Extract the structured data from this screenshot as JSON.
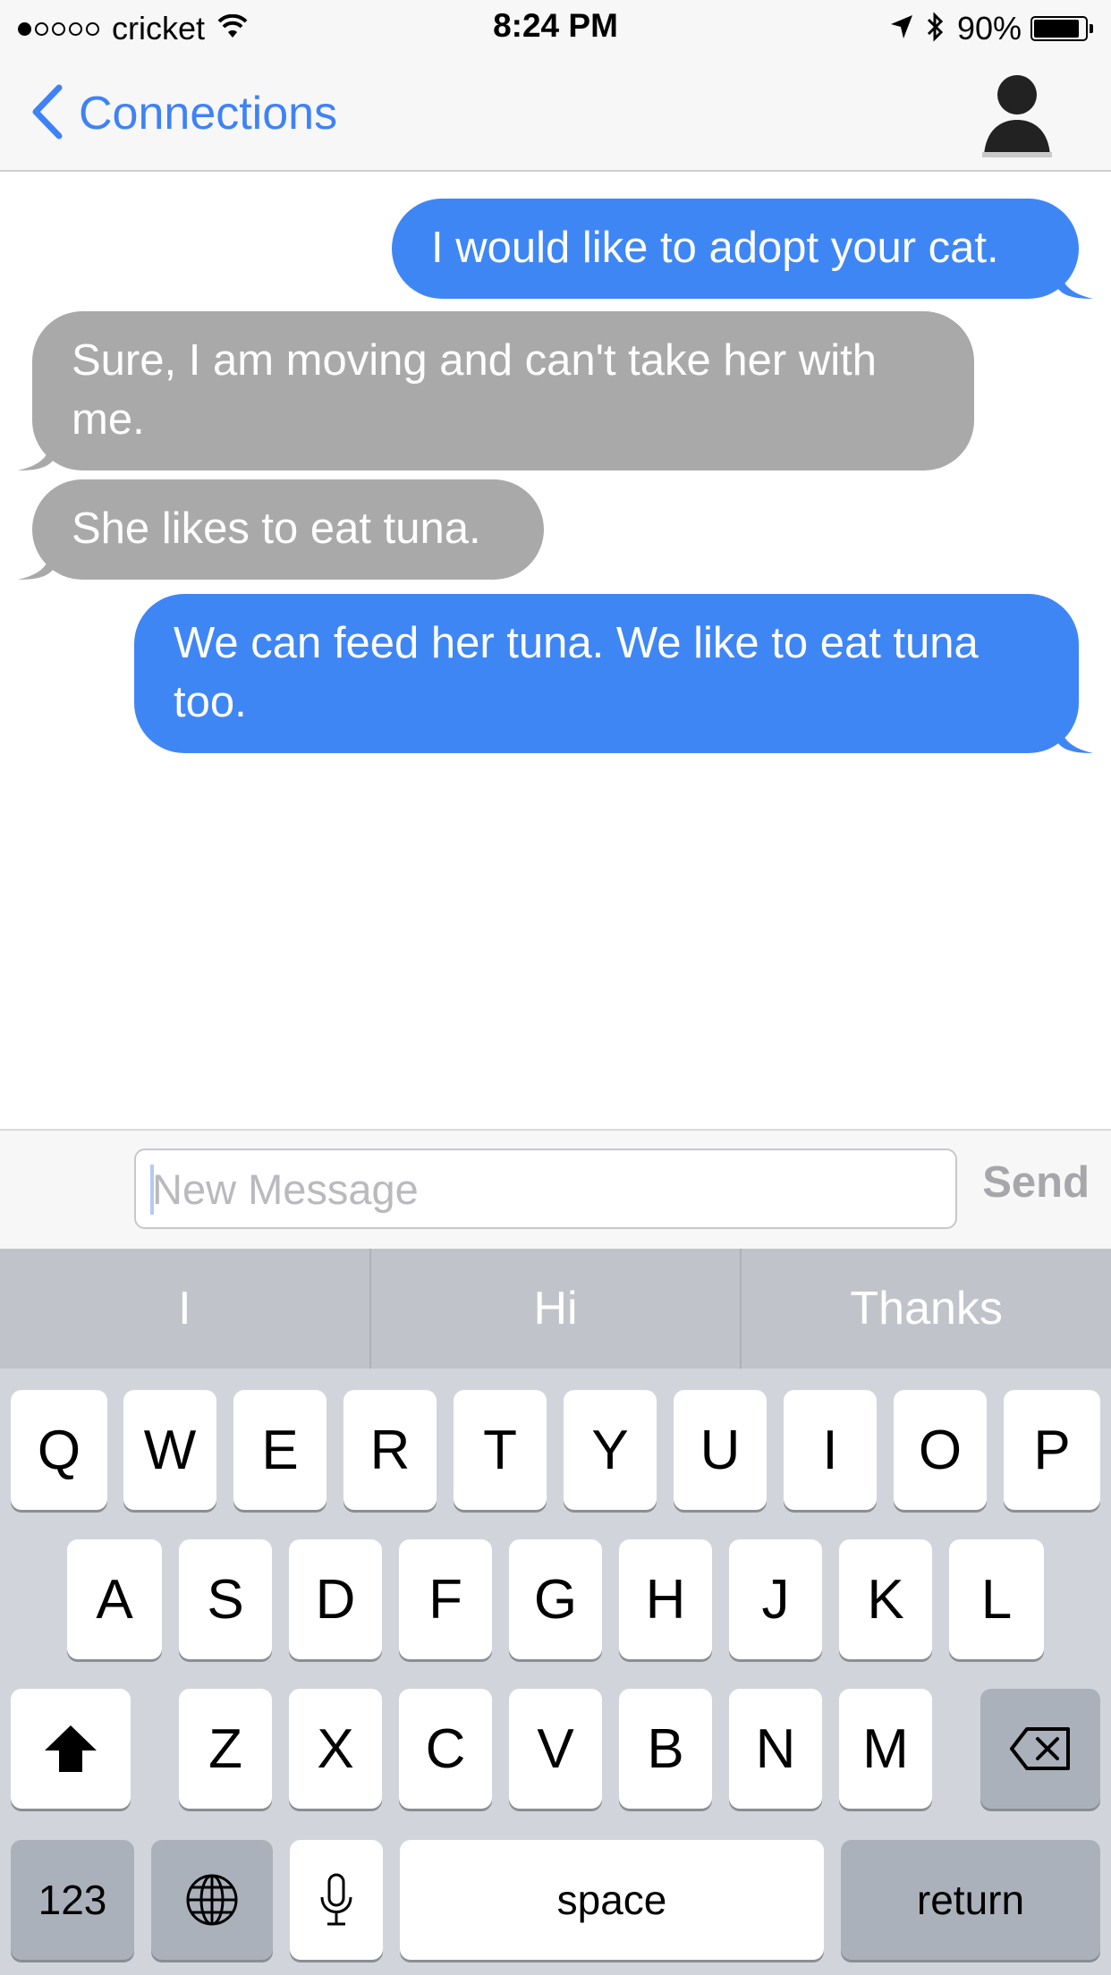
{
  "status_bar": {
    "carrier": "cricket",
    "time": "8:24 PM",
    "battery": "90%",
    "battery_level": 0.9,
    "signal_bars_filled": 1,
    "icons": [
      "signal-dots-icon",
      "wifi-icon",
      "location-arrow-icon",
      "bluetooth-icon",
      "battery-icon"
    ]
  },
  "nav": {
    "back_label": "Connections",
    "back_icon": "chevron-left-icon",
    "profile_icon": "person-silhouette-icon"
  },
  "messages": [
    {
      "direction": "outgoing",
      "text": "I would like to adopt your cat."
    },
    {
      "direction": "incoming",
      "text": "Sure, I am moving and can't take her with me."
    },
    {
      "direction": "incoming",
      "text": "She likes to eat tuna."
    },
    {
      "direction": "outgoing",
      "text": "We can feed her tuna.  We like to eat tuna too."
    }
  ],
  "input": {
    "placeholder": "New Message",
    "value": "",
    "send_label": "Send"
  },
  "predictive": [
    "I",
    "Hi",
    "Thanks"
  ],
  "keyboard": {
    "row1": [
      "Q",
      "W",
      "E",
      "R",
      "T",
      "Y",
      "U",
      "I",
      "O",
      "P"
    ],
    "row2": [
      "A",
      "S",
      "D",
      "F",
      "G",
      "H",
      "J",
      "K",
      "L"
    ],
    "row3": [
      "Z",
      "X",
      "C",
      "V",
      "B",
      "N",
      "M"
    ],
    "numbers_label": "123",
    "space_label": "space",
    "return_label": "return",
    "shift_icon": "shift-arrow-icon",
    "delete_icon": "backspace-icon",
    "globe_icon": "globe-icon",
    "mic_icon": "microphone-icon"
  },
  "colors": {
    "outgoing_bubble": "#3f86f5",
    "incoming_bubble": "#a9a9a9",
    "accent": "#3f82f7",
    "keyboard_bg": "#d1d5db",
    "predictive_bg": "#c0c4ca"
  }
}
